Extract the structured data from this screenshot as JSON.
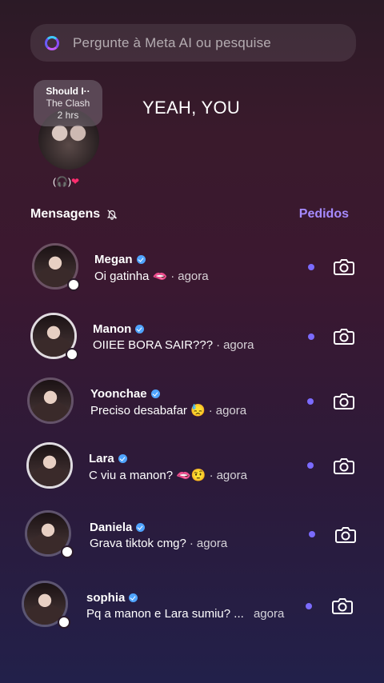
{
  "search": {
    "placeholder": "Pergunte à Meta AI ou pesquise"
  },
  "note": {
    "title": "Should I··",
    "artist": "The Clash",
    "time": "2 hrs",
    "reactions": "(🎧)"
  },
  "banner_text": "YEAH, YOU",
  "messages_section": {
    "title": "Mensagens",
    "requests_label": "Pedidos"
  },
  "conversations": [
    {
      "name": "Megan",
      "verified": true,
      "preview": "Oi gatinha 🫦",
      "time": "agora",
      "unread": true
    },
    {
      "name": "Manon",
      "verified": true,
      "preview": "OIIEE BORA SAIR???",
      "time": "agora",
      "unread": true
    },
    {
      "name": "Yoonchae",
      "verified": true,
      "preview": "Preciso desabafar 😓",
      "time": "agora",
      "unread": true
    },
    {
      "name": "Lara",
      "verified": true,
      "preview": "C viu a manon? 🫦🤨",
      "time": "agora",
      "unread": true
    },
    {
      "name": "Daniela",
      "verified": true,
      "preview": "Grava tiktok cmg?",
      "time": "agora",
      "unread": true
    },
    {
      "name": "sophia",
      "verified": true,
      "preview": "Pq a manon e Lara sumiu? ...",
      "time": "agora",
      "unread": true
    }
  ],
  "colors": {
    "accent": "#a68bff",
    "unread_dot": "#7b6bff",
    "verified": "#4fa4ff"
  },
  "icons": {
    "meta_ai": "meta-ai-ring-icon",
    "mute": "bell-off-icon",
    "camera": "camera-icon",
    "verified": "verified-badge-icon"
  }
}
